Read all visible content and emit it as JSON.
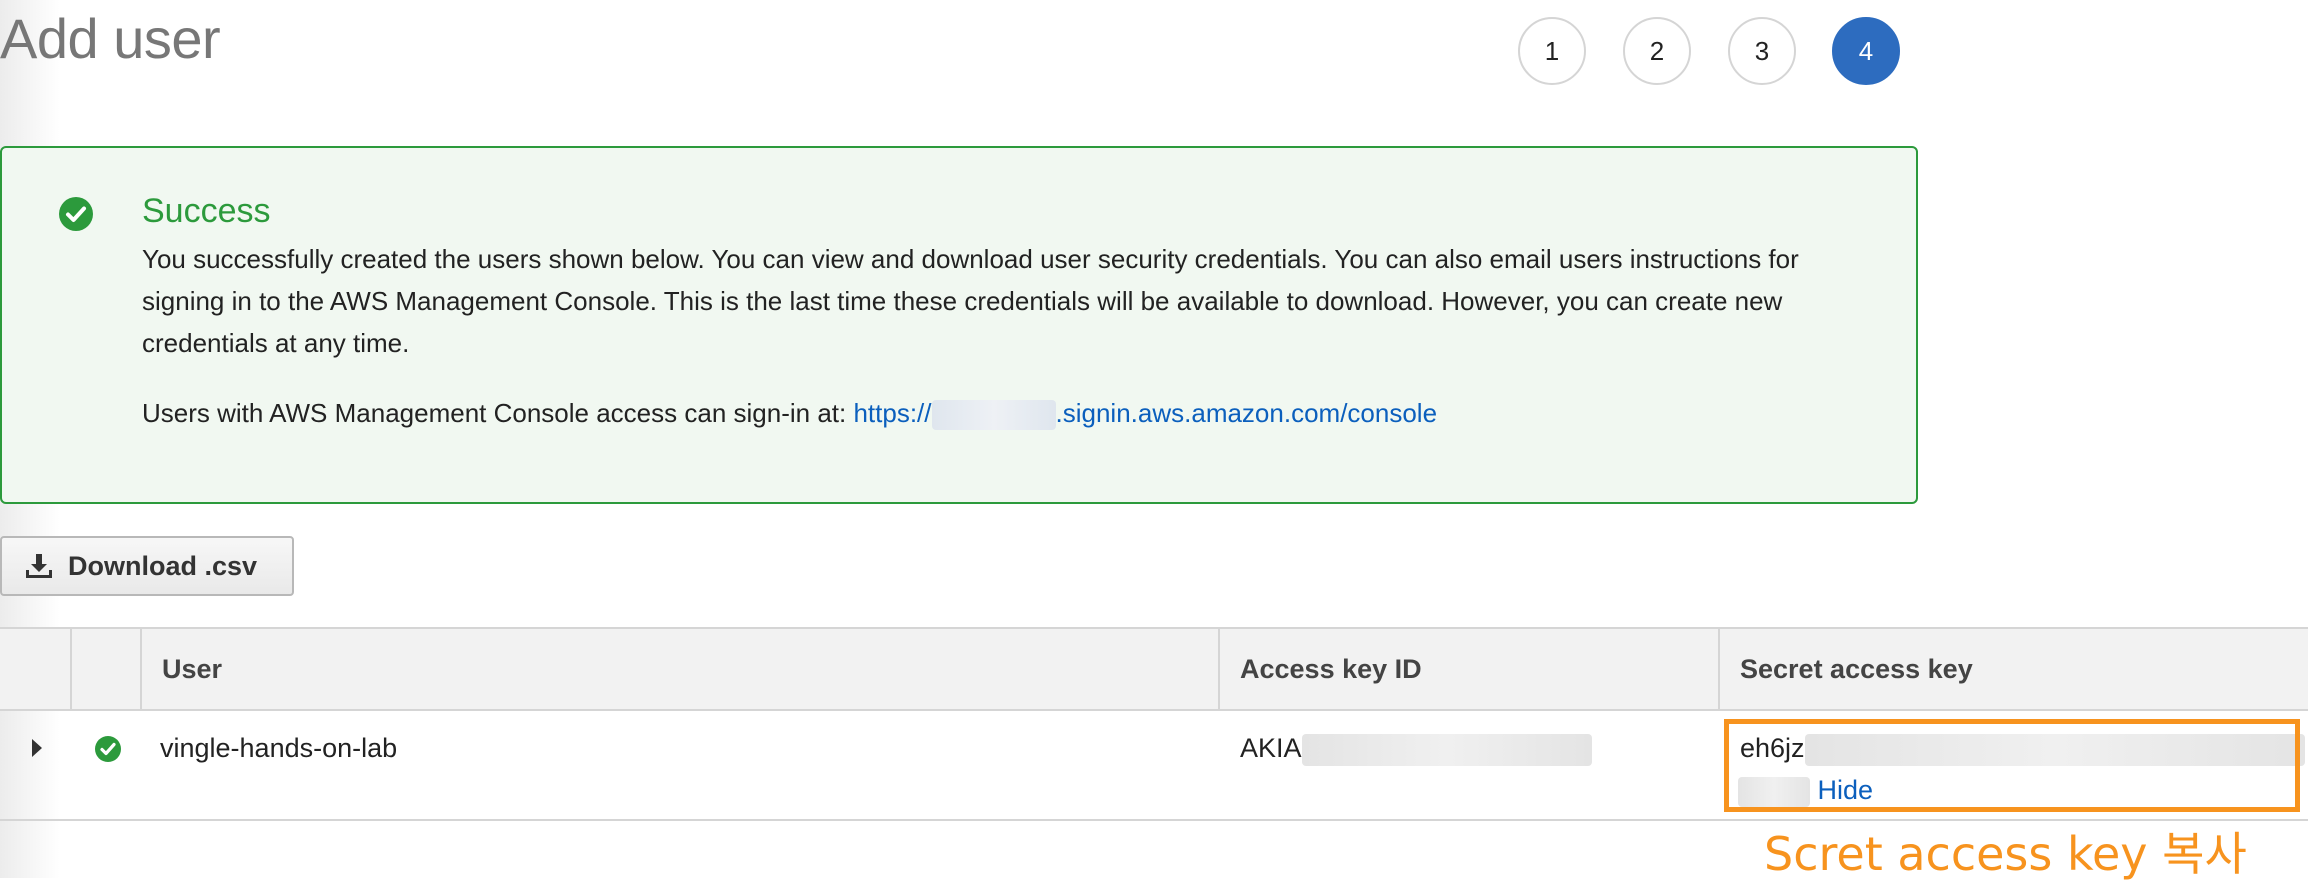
{
  "page": {
    "title": "Add user"
  },
  "steps": [
    {
      "label": "1",
      "active": false
    },
    {
      "label": "2",
      "active": false
    },
    {
      "label": "3",
      "active": false
    },
    {
      "label": "4",
      "active": true
    }
  ],
  "alert": {
    "title": "Success",
    "message": "You successfully created the users shown below. You can view and download user security credentials. You can also email users instructions for signing in to the AWS Management Console. This is the last time these credentials will be available to download. However, you can create new credentials at any time.",
    "signin_prefix": "Users with AWS Management Console access can sign-in at:",
    "signin_link_start": "https://",
    "signin_link_end": ".signin.aws.amazon.com/console",
    "icon": "check-circle-icon",
    "color": "#2c9a3c"
  },
  "download_button": {
    "label": "Download .csv",
    "icon": "download-icon"
  },
  "table": {
    "columns": [
      "User",
      "Access key ID",
      "Secret access key"
    ],
    "rows": [
      {
        "user": "vingle-hands-on-lab",
        "access_key_prefix": "AKIA",
        "secret_key_prefix": "eh6jz",
        "hide_label": "Hide",
        "status_icon": "check-circle-icon"
      }
    ]
  },
  "annotation": {
    "text": "Scret access key 복사",
    "color": "#f7931e"
  },
  "colors": {
    "accent": "#2d6cbf",
    "link": "#0b5fbd",
    "success": "#2c9a3c",
    "highlight": "#f7931e"
  }
}
